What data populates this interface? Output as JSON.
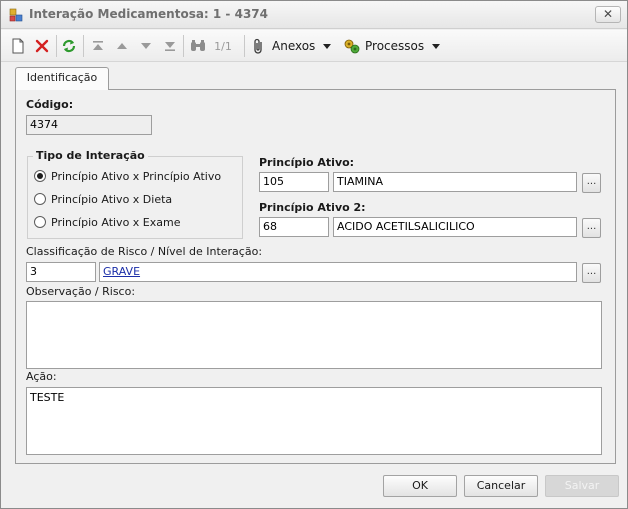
{
  "window": {
    "title": "Interação Medicamentosa: 1 - 4374",
    "close_glyph": "✕"
  },
  "toolbar": {
    "page_indicator": "1/1",
    "anexos_label": "Anexos",
    "processos_label": "Processos",
    "icons": [
      "new-icon",
      "delete-icon",
      "refresh-icon",
      "first-icon",
      "prev-icon",
      "next-icon",
      "last-icon",
      "find-icon",
      "paperclip-icon",
      "process-icon"
    ]
  },
  "tabs": [
    {
      "label": "Identificação",
      "active": true
    }
  ],
  "form": {
    "codigo": {
      "label": "Código:",
      "value": "4374"
    },
    "tipo_interacao": {
      "title": "Tipo de Interação",
      "options": [
        {
          "label": "Princípio Ativo x Princípio Ativo",
          "checked": true
        },
        {
          "label": "Princípio Ativo x Dieta",
          "checked": false
        },
        {
          "label": "Princípio Ativo x Exame",
          "checked": false
        }
      ]
    },
    "principio_ativo": {
      "label": "Princípio Ativo:",
      "code": "105",
      "name": "TIAMINA",
      "button": "..."
    },
    "principio_ativo_2": {
      "label": "Princípio Ativo 2:",
      "code": "68",
      "name": "ACIDO ACETILSALICILICO",
      "button": "..."
    },
    "classificacao": {
      "label": "Classificação de Risco / Nível de Interação:",
      "code": "3",
      "name": "GRAVE",
      "button": "..."
    },
    "observacao": {
      "label": "Observação / Risco:",
      "value": ""
    },
    "acao": {
      "label": "Ação:",
      "value": "TESTE"
    }
  },
  "buttons": {
    "ok": "OK",
    "cancelar": "Cancelar",
    "salvar": "Salvar"
  },
  "colors": {
    "link": "#1b2ea8",
    "refresh_green": "#2e9a2e",
    "delete_red": "#d42020"
  }
}
